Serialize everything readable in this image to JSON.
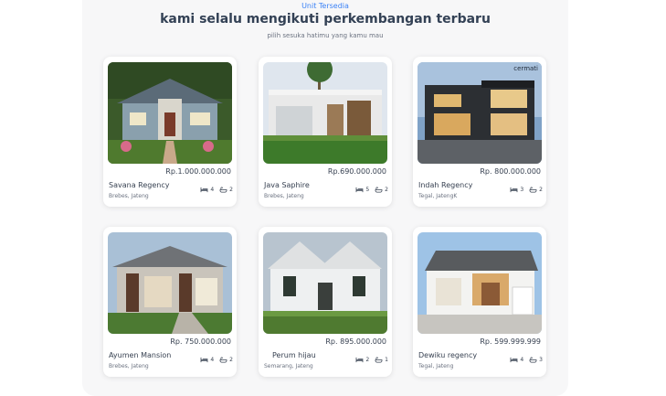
{
  "section": {
    "subtitle": "Unit Tersedia",
    "title": "kami selalu mengikuti perkembangan terbaru",
    "tagline": "pilih sesuka hatimu yang kamu mau"
  },
  "units": [
    {
      "name": "Savana Regency",
      "location": "Brebes, Jateng",
      "price": "Rp.1.000.000.000",
      "beds": "4",
      "baths": "2"
    },
    {
      "name": "Java Saphire",
      "location": "Brebes, Jateng",
      "price": "Rp.690.000.000",
      "beds": "5",
      "baths": "2"
    },
    {
      "name": "Indah Regency",
      "location": "Tegal, JatengK",
      "price": "Rp. 800.000.000",
      "beds": "3",
      "baths": "2"
    },
    {
      "name": "Ayumen Mansion",
      "location": "Brebes, Jateng",
      "price": "Rp. 750.000.000",
      "beds": "4",
      "baths": "2"
    },
    {
      "name": "Perum hijau",
      "location": "Semarang, Jateng",
      "price": "Rp. 895.000.000",
      "beds": "2",
      "baths": "1"
    },
    {
      "name": "Dewiku regency",
      "location": "Tegal, Jateng",
      "price": "Rp. 599.999.999",
      "beds": "4",
      "baths": "3"
    }
  ],
  "icons": {
    "beds": "bed-icon",
    "baths": "bathtub-icon"
  },
  "watermark": "cermati"
}
